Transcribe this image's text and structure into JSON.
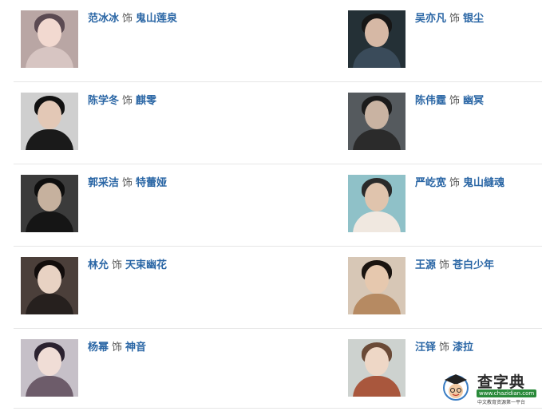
{
  "separator": "饰",
  "rows": [
    [
      {
        "actor": "范冰冰",
        "role": "鬼山莲泉"
      },
      {
        "actor": "吴亦凡",
        "role": "银尘"
      }
    ],
    [
      {
        "actor": "陈学冬",
        "role": "麒零"
      },
      {
        "actor": "陈伟霆",
        "role": "幽冥"
      }
    ],
    [
      {
        "actor": "郭采洁",
        "role": "特蕾娅"
      },
      {
        "actor": "严屹宽",
        "role": "鬼山縫魂"
      }
    ],
    [
      {
        "actor": "林允",
        "role": "天束幽花"
      },
      {
        "actor": "王源",
        "role": "苍白少年"
      }
    ],
    [
      {
        "actor": "杨幂",
        "role": "神音"
      },
      {
        "actor": "汪铎",
        "role": "漆拉"
      }
    ]
  ],
  "watermark": {
    "title": "查字典",
    "url": "www.chazidian.com",
    "slogan": "中文教育资源第一平台"
  },
  "colors": {
    "link": "#2a66a5",
    "separator_text": "#555555",
    "divider": "#e6e6e6",
    "watermark_url_bg": "#2a8a3a"
  }
}
